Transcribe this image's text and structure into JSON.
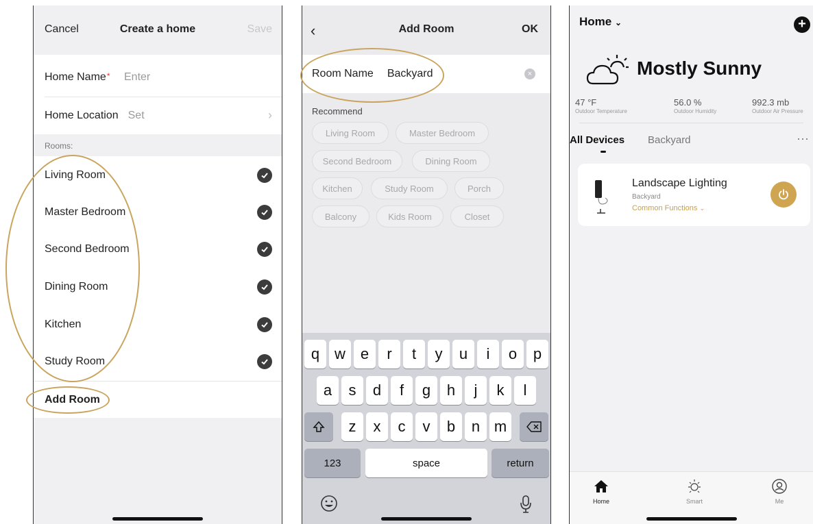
{
  "create_home": {
    "nav": {
      "cancel": "Cancel",
      "title": "Create a home",
      "save": "Save"
    },
    "home_name": {
      "label": "Home Name",
      "required_mark": "*",
      "placeholder": "Enter"
    },
    "home_location": {
      "label": "Home Location",
      "value": "Set"
    },
    "rooms_label": "Rooms:",
    "rooms": [
      "Living Room",
      "Master Bedroom",
      "Second Bedroom",
      "Dining Room",
      "Kitchen",
      "Study Room"
    ],
    "add_room": "Add Room"
  },
  "add_room": {
    "nav": {
      "title": "Add Room",
      "ok": "OK"
    },
    "room_name_label": "Room Name",
    "room_name_value": "Backyard",
    "recommend_label": "Recommend",
    "chips": [
      "Living Room",
      "Master Bedroom",
      "Second Bedroom",
      "Dining Room",
      "Kitchen",
      "Study Room",
      "Porch",
      "Balcony",
      "Kids Room",
      "Closet"
    ],
    "keyboard": {
      "row1": [
        "q",
        "w",
        "e",
        "r",
        "t",
        "y",
        "u",
        "i",
        "o",
        "p"
      ],
      "row2": [
        "a",
        "s",
        "d",
        "f",
        "g",
        "h",
        "j",
        "k",
        "l"
      ],
      "row3": [
        "z",
        "x",
        "c",
        "v",
        "b",
        "n",
        "m"
      ],
      "numbers": "123",
      "space": "space",
      "return": "return"
    }
  },
  "home": {
    "home_selector": "Home",
    "weather": "Mostly Sunny",
    "stats": [
      {
        "value": "47 °F",
        "label": "Outdoor Temperature"
      },
      {
        "value": "56.0 %",
        "label": "Outdoor Humidity"
      },
      {
        "value": "992.3 mb",
        "label": "Outdoor Air Pressure"
      }
    ],
    "tabs": [
      "All Devices",
      "Backyard"
    ],
    "device": {
      "name": "Landscape Lighting",
      "room": "Backyard",
      "functions": "Common Functions"
    },
    "tabbar": [
      "Home",
      "Smart",
      "Me"
    ]
  },
  "colors": {
    "accent_gold": "#c9a45c",
    "power_button": "#cfa552",
    "required_red": "#e23b3b"
  }
}
